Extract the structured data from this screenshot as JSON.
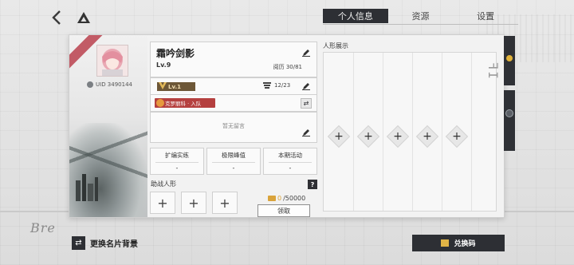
{
  "header": {
    "tabs": [
      {
        "label": "个人信息",
        "active": true
      },
      {
        "label": "资源",
        "active": false
      },
      {
        "label": "设置",
        "active": false
      }
    ]
  },
  "profile": {
    "uid": "UID 3490144",
    "name": "霜吟剑影",
    "level": "Lv.9",
    "experience": "阅历 30/81",
    "rank_level": "Lv.1",
    "collection_count": "12/23",
    "guild_tag": "克罗丽科 · 入队",
    "message_placeholder": "暂无留言"
  },
  "stats": [
    {
      "title": "扩编实练",
      "value": "-"
    },
    {
      "title": "极限峰值",
      "value": "-"
    },
    {
      "title": "本期活动",
      "value": "-"
    }
  ],
  "support": {
    "title": "助战人形",
    "help": "?",
    "slot_symbol": "+",
    "currency_current": "0",
    "currency_max": "/50000",
    "claim_label": "领取"
  },
  "showcase": {
    "title": "人形展示",
    "slot_symbol": "+"
  },
  "footer": {
    "change_card_bg": "更换名片背景",
    "redeem_code": "兑换码"
  },
  "colors": {
    "accent_dark": "#2d2f34",
    "guild_red": "#b5403f",
    "rank_brown": "#6d5737",
    "coin_gold": "#d9a33b"
  }
}
